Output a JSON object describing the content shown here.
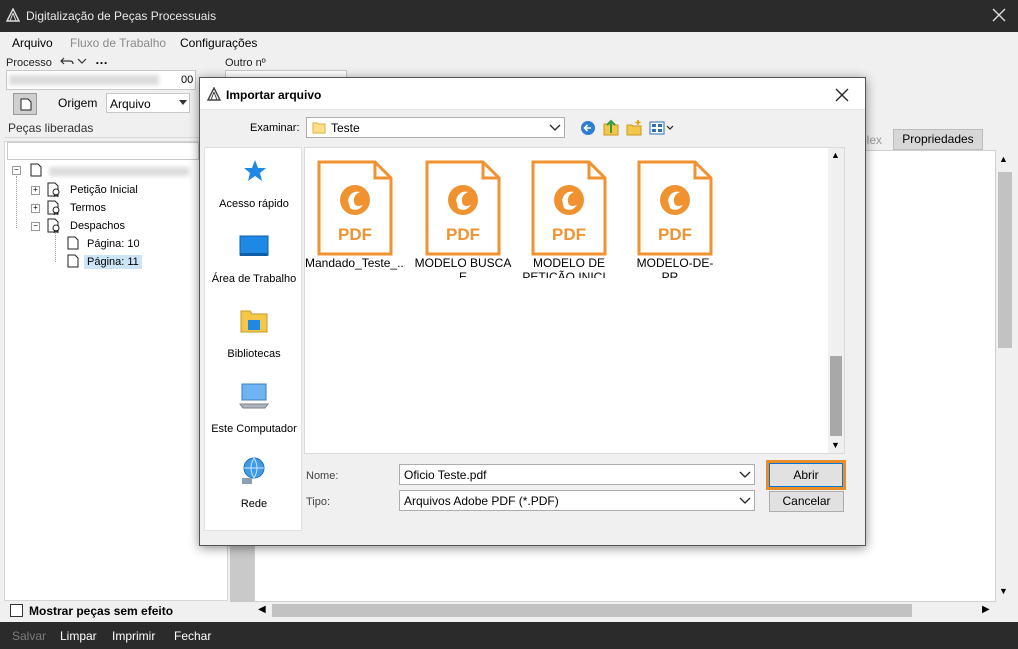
{
  "window": {
    "title": "Digitalização de Peças Processuais"
  },
  "menu": {
    "arquivo": "Arquivo",
    "fluxo": "Fluxo de Trabalho",
    "config": "Configurações"
  },
  "form": {
    "processo_label": "Processo",
    "outro_label": "Outro nº",
    "processo_suffix": "00",
    "origem_label": "Origem",
    "origem_value": "Arquivo"
  },
  "left_panel": {
    "title": "Peças liberadas",
    "tree": {
      "items": [
        "Petição Inicial",
        "Termos",
        "Despachos"
      ],
      "pages": [
        "Página: 10",
        "Página: 11"
      ]
    },
    "checkbox_label": "Mostrar peças sem efeito"
  },
  "right_tabs": {
    "partial": "plex",
    "propriedades": "Propriedades"
  },
  "bottom": {
    "salvar": "Salvar",
    "limpar": "Limpar",
    "imprimir": "Imprimir",
    "fechar": "Fechar"
  },
  "dialog": {
    "title": "Importar arquivo",
    "examinar_label": "Examinar:",
    "folder": "Teste",
    "places": [
      "Acesso rápido",
      "Área de Trabalho",
      "Bibliotecas",
      "Este Computador",
      "Rede"
    ],
    "files": [
      "Mandado_Teste_...",
      "MODELO BUSCA E APREENSÃO.pdf",
      "MODELO DE PETIÇÃO INICI...",
      "MODELO-DE-PR..."
    ],
    "pdf_badge": "PDF",
    "nome_label": "Nome:",
    "nome_value": "Oficio Teste.pdf",
    "tipo_label": "Tipo:",
    "tipo_value": "Arquivos Adobe PDF (*.PDF)",
    "open_button": "Abrir",
    "cancel_button": "Cancelar"
  },
  "colors": {
    "titlebar": "#2b2b2b",
    "pdf_orange": "#f0922f",
    "highlight": "#e88d2a"
  }
}
